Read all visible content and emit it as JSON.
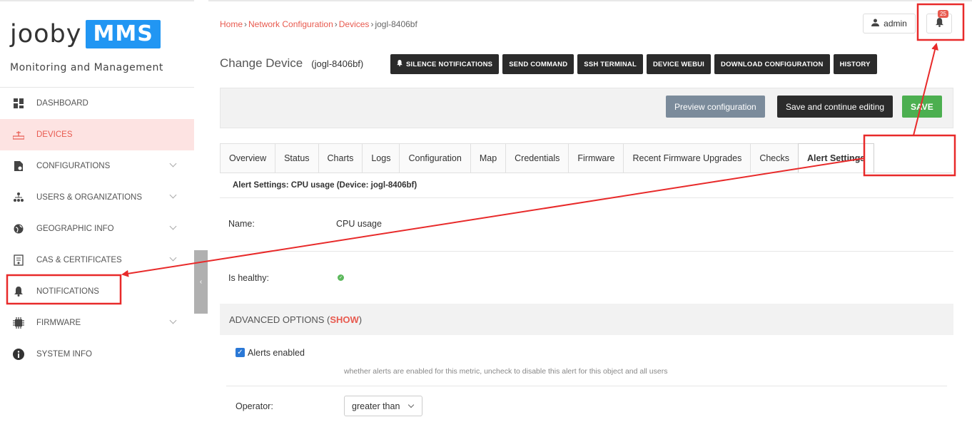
{
  "brand": {
    "logo_word": "jooby",
    "logo_box": "MMS",
    "tagline": "Monitoring and Management",
    "accent_color": "#e85a4f",
    "logo_color": "#2196f3"
  },
  "sidebar": {
    "items": [
      {
        "label": "DASHBOARD",
        "icon": "dashboard-icon"
      },
      {
        "label": "DEVICES",
        "icon": "network-icon",
        "active": true
      },
      {
        "label": "CONFIGURATIONS",
        "icon": "file-gear-icon"
      },
      {
        "label": "USERS & ORGANIZATIONS",
        "icon": "org-chart-icon"
      },
      {
        "label": "GEOGRAPHIC INFO",
        "icon": "globe-icon"
      },
      {
        "label": "CAS & CERTIFICATES",
        "icon": "certificate-icon"
      },
      {
        "label": "NOTIFICATIONS",
        "icon": "bell-icon"
      },
      {
        "label": "FIRMWARE",
        "icon": "chip-icon"
      },
      {
        "label": "SYSTEM INFO",
        "icon": "info-icon"
      }
    ],
    "collapse_glyph": "‹"
  },
  "breadcrumb": {
    "home": "Home",
    "sep": "›",
    "network": "Network Configuration",
    "devices": "Devices",
    "current": "jogl-8406bf"
  },
  "header": {
    "user": "admin",
    "notif_count": "25"
  },
  "page": {
    "title": "Change Device",
    "subtitle": "(jogl-8406bf)"
  },
  "actions": {
    "silence": "SILENCE NOTIFICATIONS",
    "send_command": "SEND COMMAND",
    "ssh": "SSH TERMINAL",
    "webui": "DEVICE WEBUI",
    "download": "DOWNLOAD CONFIGURATION",
    "history": "HISTORY"
  },
  "submit": {
    "preview": "Preview configuration",
    "save_continue": "Save and continue editing",
    "save": "SAVE"
  },
  "tabs": [
    "Overview",
    "Status",
    "Charts",
    "Logs",
    "Configuration",
    "Map",
    "Credentials",
    "Firmware",
    "Recent Firmware Upgrades",
    "Checks",
    "Alert Settings"
  ],
  "alert": {
    "title": "Alert Settings: CPU usage (Device: jogl-8406bf)",
    "name_label": "Name:",
    "name_value": "CPU usage",
    "healthy_label": "Is healthy:",
    "advanced": "ADVANCED OPTIONS (",
    "show": "SHOW",
    "advanced_close": ")",
    "alerts_enabled": "Alerts enabled",
    "alerts_help": "whether alerts are enabled for this metric, uncheck to disable this alert for this object and all users",
    "operator_label": "Operator:",
    "operator_value": "greater than"
  }
}
